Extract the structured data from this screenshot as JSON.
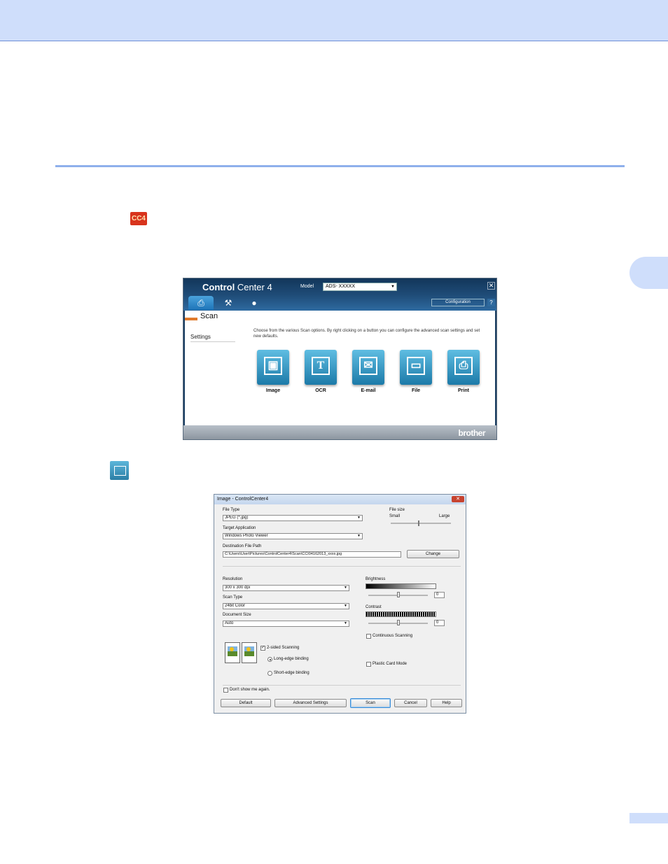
{
  "controlcenter": {
    "logo_bold": "Control",
    "logo_rest": " Center 4",
    "model_label": "Model",
    "model_value": "ADS- XXXXX",
    "close_symbol": "✕",
    "config_label": "Configuration",
    "help_symbol": "?",
    "section_title": "Scan",
    "sidebar_item": "Settings",
    "description": "Choose from the various Scan options. By right clicking on a button you can configure the advanced scan settings and set new defaults.",
    "scan_buttons": [
      {
        "label": "Image",
        "icon": "image-icon"
      },
      {
        "label": "OCR",
        "icon": "ocr-icon"
      },
      {
        "label": "E-mail",
        "icon": "email-icon"
      },
      {
        "label": "File",
        "icon": "folder-icon"
      },
      {
        "label": "Print",
        "icon": "printer-icon"
      }
    ],
    "brand": "brother",
    "cc4_badge": "CC4"
  },
  "dialog": {
    "title": "Image - ControlCenter4",
    "close_symbol": "✕",
    "file_type_label": "File Type",
    "file_type_value": "JPEG (*.jpg)",
    "target_app_label": "Target Application",
    "target_app_value": "Windows Photo Viewer",
    "dest_path_label": "Destination File Path",
    "dest_path_value": "C:\\Users\\User\\Pictures\\ControlCenter4\\Scan\\CCI04162013_xxxx.jpg",
    "change_label": "Change",
    "file_size_label": "File size",
    "file_size_small": "Small",
    "file_size_large": "Large",
    "resolution_label": "Resolution",
    "resolution_value": "300 x 300 dpi",
    "scan_type_label": "Scan Type",
    "scan_type_value": "24bit Color",
    "doc_size_label": "Document Size",
    "doc_size_value": "Auto",
    "brightness_label": "Brightness",
    "brightness_value": "0",
    "contrast_label": "Contrast",
    "contrast_value": "0",
    "continuous_label": "Continuous Scanning",
    "two_sided_label": "2-sided Scanning",
    "long_edge_label": "Long-edge binding",
    "short_edge_label": "Short-edge binding",
    "plastic_card_label": "Plastic Card Mode",
    "dont_show_label": "Don't show me again.",
    "buttons": {
      "default": "Default",
      "advanced": "Advanced Settings",
      "scan": "Scan",
      "cancel": "Cancel",
      "help": "Help"
    }
  }
}
